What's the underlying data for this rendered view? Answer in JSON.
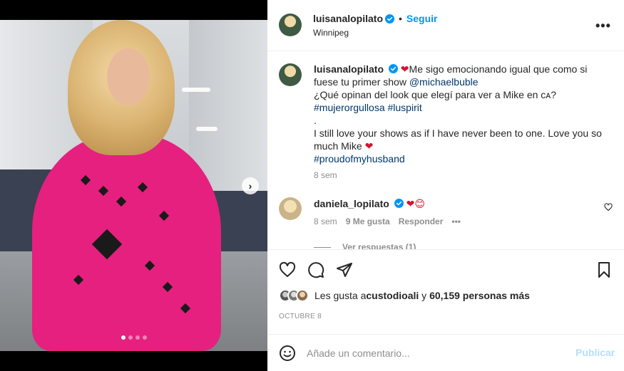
{
  "post": {
    "media": {
      "slide_count": 4,
      "active_slide": 1,
      "next_icon": "chevron-right-icon",
      "next_glyph": "›"
    },
    "author": {
      "username": "luisanalopilato",
      "verified_icon": "verified-badge-icon",
      "bullet": "•",
      "follow_label": "Seguir",
      "location": "Winnipeg",
      "more_glyph": "•••"
    },
    "caption": {
      "username": "luisanalopilato",
      "heart": "❤",
      "line1": "Me sigo emocionando igual que como si fuese tu primer show ",
      "mention": "@michaelbuble",
      "line2": "¿Qué opinan del look que elegí para ver a Mike en ᴄᴀ?",
      "hashtags1": "#mujerorgullosa #luspirit",
      "dot": ".",
      "line3": "I still love your shows as if I have never been to one. Love you so much Mike ",
      "hearts2": "❤",
      "hashtag2": "#proudofmyhusband",
      "time": "8 sem"
    },
    "comment": {
      "username": "daniela_lopilato",
      "text": "❤😊",
      "time": "8 sem",
      "likes": "9 Me gusta",
      "reply_label": "Responder",
      "more_glyph": "•••",
      "view_replies": "Ver respuestas (1)"
    },
    "actions": {
      "likes_prefix": "Les gusta a ",
      "liked_by": "custodioali",
      "likes_middle": " y ",
      "likes_count": "60,159 personas más",
      "date": "OCTUBRE 8"
    },
    "composer": {
      "placeholder": "Añade un comentario...",
      "publish_label": "Publicar"
    },
    "colors": {
      "link_blue": "#0095f6",
      "text": "#262626",
      "muted": "#8e8e8e",
      "dress_pink": "#e5207f"
    }
  }
}
